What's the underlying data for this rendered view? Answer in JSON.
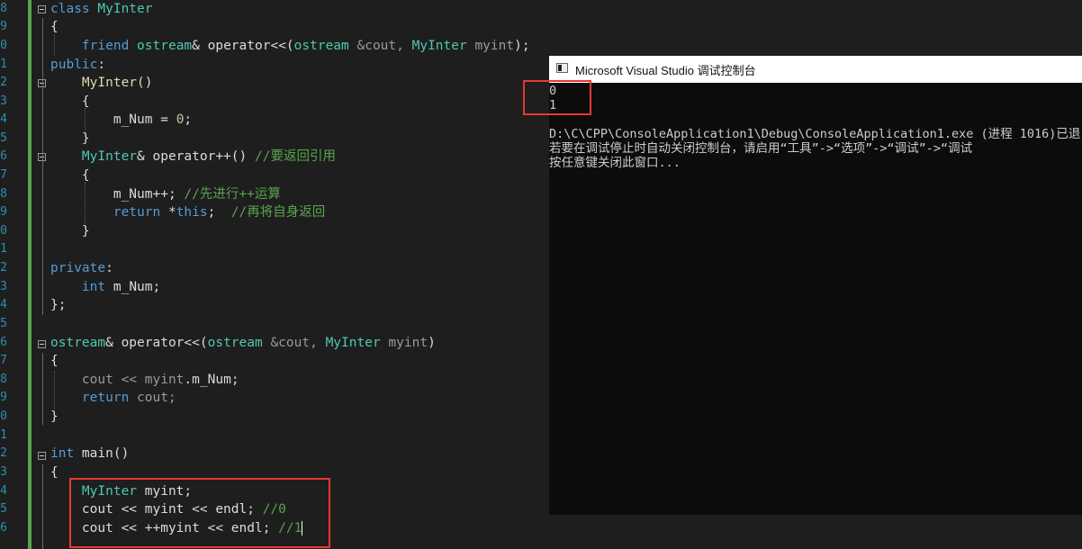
{
  "editor": {
    "line_numbers": [
      "8",
      "9",
      "0",
      "1",
      "2",
      "3",
      "4",
      "5",
      "6",
      "7",
      "8",
      "9",
      "0",
      "1",
      "2",
      "3",
      "4",
      "5",
      "6",
      "7",
      "8",
      "9",
      "0",
      "1",
      "2",
      "3",
      "4",
      "5",
      "6"
    ],
    "code": {
      "class_kw": "class",
      "class_name": "MyInter",
      "brace_open": "{",
      "brace_close": "}",
      "brace_close_semi": "};",
      "friend_kw": "friend",
      "ostream": "ostream",
      "amp": "&",
      "operator_shift": " operator<<(",
      "amp_cout": " &cout, ",
      "myint_param": " myint",
      "close_semi": ");",
      "public_kw": "public",
      "colon": ":",
      "ctor_name": "MyInter",
      "ctor_parens": "()",
      "m_num_assign": "m_Num = ",
      "zero": "0",
      "semicolon": ";",
      "ref_return": "MyInter",
      "op_inc": "& operator++() ",
      "cmt_return_ref": "//要返回引用",
      "m_num_inc": "m_Num++; ",
      "cmt_inc_first": "//先进行++运算",
      "return_kw": "return",
      "deref": " *",
      "this_kw": "this",
      "semi_space": ";  ",
      "cmt_return_self": "//再将自身返回",
      "private_kw": "private",
      "int_kw": "int",
      "m_num_decl": " m_Num;",
      "ostream_ret": "ostream",
      "op_def": "& operator<<(",
      "amp_cout2": " &cout, ",
      "myint2": " myint",
      "close_paren": ")",
      "cout_shift": "cout << ",
      "myint_dot": "myint",
      "dot_mnum": ".",
      "mnum": "m_Num",
      "semi": ";",
      "return_cout": " cout;",
      "main_kw": "int",
      "main_fn": " main()",
      "decl_type": "MyInter",
      "decl_var": " myint;",
      "cout_line1": "cout << myint << endl; ",
      "cmt_0": "//0",
      "cout_line2": "cout << ++myint << endl; ",
      "cmt_1": "//1"
    }
  },
  "console": {
    "title": "Microsoft Visual Studio 调试控制台",
    "output_lines": [
      "0",
      "1"
    ],
    "exit_line": "D:\\C\\CPP\\ConsoleApplication1\\Debug\\ConsoleApplication1.exe (进程 1016)已退",
    "hint_line": "若要在调试停止时自动关闭控制台，请启用“工具”->“选项”->“调试”->“调试",
    "press_key_line": "按任意键关闭此窗口..."
  },
  "colors": {
    "keyword": "#569cd6",
    "type": "#4ec9b0",
    "comment": "#57a64a",
    "highlight_box": "#e53935"
  }
}
